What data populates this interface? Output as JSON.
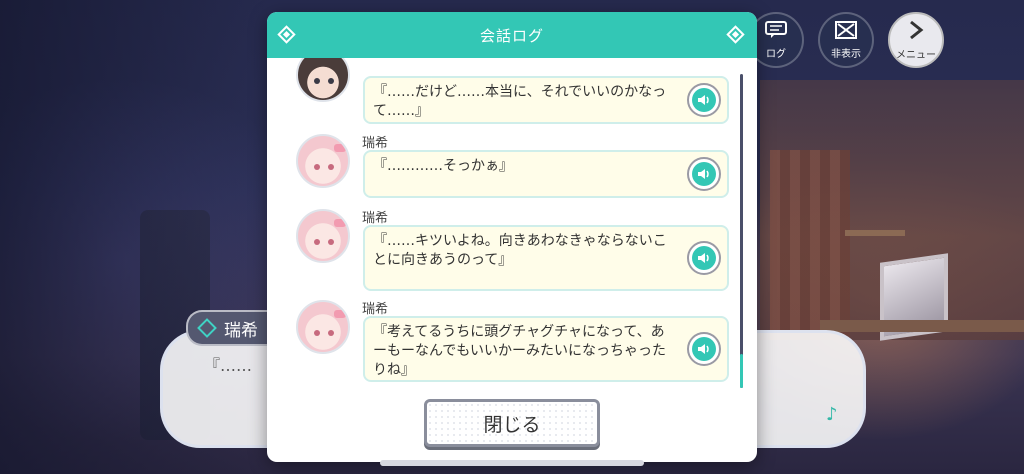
{
  "hud": {
    "log_label": "ログ",
    "hide_label": "非表示",
    "menu_label": "メニュー"
  },
  "background_textbox": {
    "speaker": "瑞希",
    "text": "『……"
  },
  "dialog": {
    "title": "会話ログ",
    "close_label": "閉じる",
    "entries": [
      {
        "speaker": "",
        "text": "『……だけど……本当に、それでいいのかなって……』"
      },
      {
        "speaker": "瑞希",
        "text": "『…………そっかぁ』"
      },
      {
        "speaker": "瑞希",
        "text": "『……キツいよね。向きあわなきゃならないことに向きあうのって』"
      },
      {
        "speaker": "瑞希",
        "text": "『考えてるうちに頭グチャグチャになって、あーもーなんでもいいかーみたいになっちゃったりね』"
      }
    ]
  },
  "colors": {
    "accent": "#33c7b5",
    "bubble_bg": "#fffde9",
    "bubble_border": "#cfeeea"
  }
}
